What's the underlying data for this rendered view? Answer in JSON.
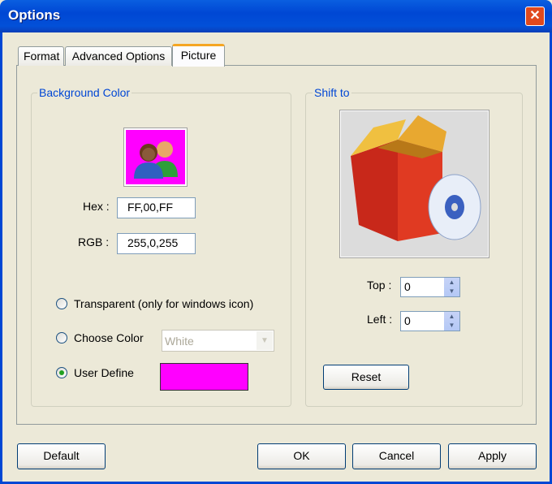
{
  "window": {
    "title": "Options",
    "close_label": "✕"
  },
  "tabs": [
    {
      "label": "Format"
    },
    {
      "label": "Advanced Options"
    },
    {
      "label": "Picture"
    }
  ],
  "background_color": {
    "group_label": "Background Color",
    "preview_color": "#FF00FF",
    "hex_label": "Hex :",
    "hex_value": "FF,00,FF",
    "rgb_label": "RGB :",
    "rgb_value": "255,0,255",
    "options": [
      {
        "label": "Transparent (only for windows icon)",
        "selected": false
      },
      {
        "label": "Choose Color",
        "selected": false
      },
      {
        "label": "User Define",
        "selected": true
      }
    ],
    "choose_color_value": "White",
    "user_color": "#FF00FF"
  },
  "shift_to": {
    "group_label": "Shift to",
    "top_label": "Top :",
    "top_value": "0",
    "left_label": "Left :",
    "left_value": "0",
    "reset_label": "Reset"
  },
  "buttons": {
    "default": "Default",
    "ok": "OK",
    "cancel": "Cancel",
    "apply": "Apply"
  }
}
